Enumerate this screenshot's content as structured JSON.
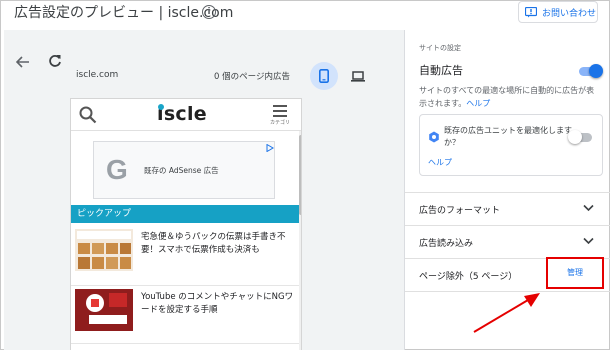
{
  "header": {
    "title": "広告設定のプレビュー | iscle.com",
    "info_icon": "i",
    "contact_label": "お問い合わせ"
  },
  "preview": {
    "url": "iscle.com",
    "ad_count": "0 個のページ内広告",
    "site": {
      "logo_text": "iscle",
      "menu_caption": "カテゴリ",
      "ad_text": "既存の AdSense 広告",
      "ad_logo": "G",
      "pickup_label": "ピックアップ",
      "articles": [
        {
          "text": "宅急便＆ゆうパックの伝票は手書き不要！スマホで伝票作成も決済も"
        },
        {
          "text": "YouTube のコメントやチャットにNGワードを設定する手順"
        }
      ]
    }
  },
  "settings": {
    "section_label": "サイトの設定",
    "auto_ads_label": "自動広告",
    "auto_ads_enabled": true,
    "auto_ads_desc": "サイトのすべての最適な場所に自動的に広告が表示されます。",
    "help_label": "ヘルプ",
    "optimize_text": "既存の広告ユニットを最適化しますか？",
    "optimize_enabled": false,
    "optimize_help": "ヘルプ",
    "rows": [
      {
        "label": "広告のフォーマット"
      },
      {
        "label": "広告読み込み"
      }
    ],
    "page_exclusion_label": "ページ除外（5 ページ）",
    "manage_label": "管理"
  },
  "colors": {
    "accent": "#1a73e8",
    "pickup": "#16a1c5",
    "highlight": "#e50000"
  }
}
